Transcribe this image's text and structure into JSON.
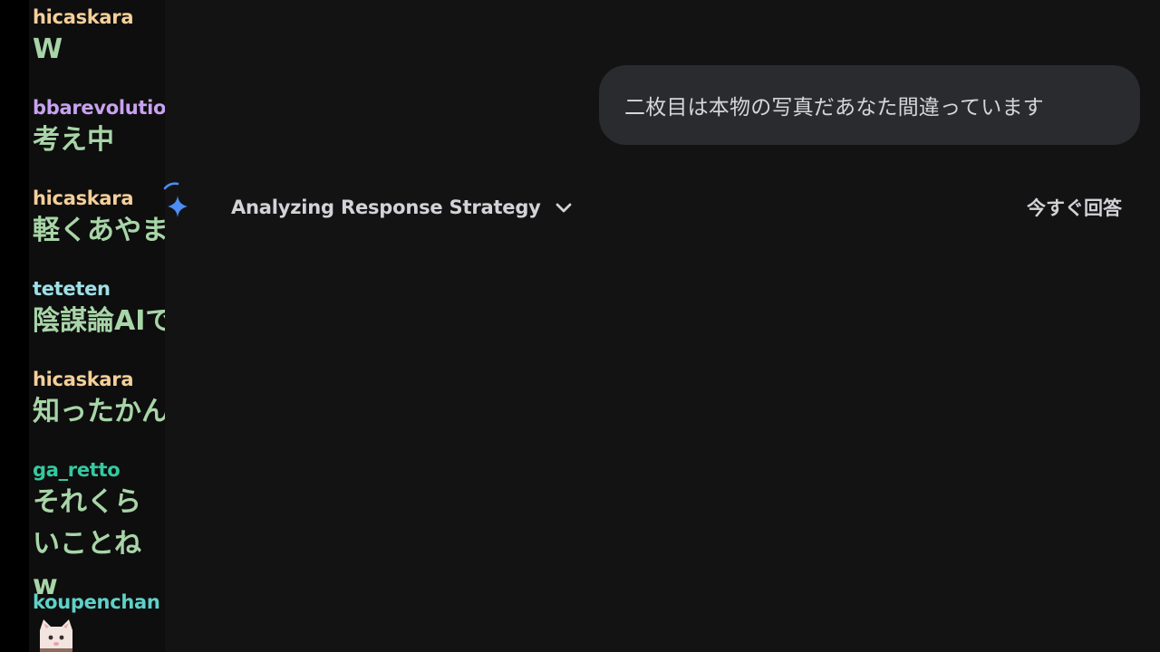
{
  "chat": {
    "messages": [
      {
        "user": "hicaskara",
        "user_color": "#f5cf9a",
        "text": "W"
      },
      {
        "user": "bbarevolution",
        "user_color": "#c8a2f0",
        "text": "考え中"
      },
      {
        "user": "hicaskara",
        "user_color": "#f5cf9a",
        "text": "軽くあやま"
      },
      {
        "user": "teteten",
        "user_color": "#9fe0e6",
        "text": "陰謀論AIで"
      },
      {
        "user": "hicaskara",
        "user_color": "#f5cf9a",
        "text": "知ったかん"
      },
      {
        "user": "ga_retto",
        "user_color": "#35c9a0",
        "text": "それくらいことねw"
      },
      {
        "user": "koupenchan",
        "user_color": "#5fd1c8",
        "text": ""
      }
    ]
  },
  "conversation": {
    "user_message": "二枚目は本物の写真だあなた間違っています",
    "thinking_label": "Analyzing Response Strategy",
    "answer_now_label": "今すぐ回答"
  },
  "icons": {
    "sparkle": "gemini-sparkle-icon",
    "chevron": "chevron-down-icon",
    "emote": "cat-emote-icon"
  },
  "colors": {
    "background": "#131314",
    "bubble": "#2a2b2e",
    "sparkle_blue": "#4c8df6",
    "chat_text": "#a8d5a8"
  }
}
